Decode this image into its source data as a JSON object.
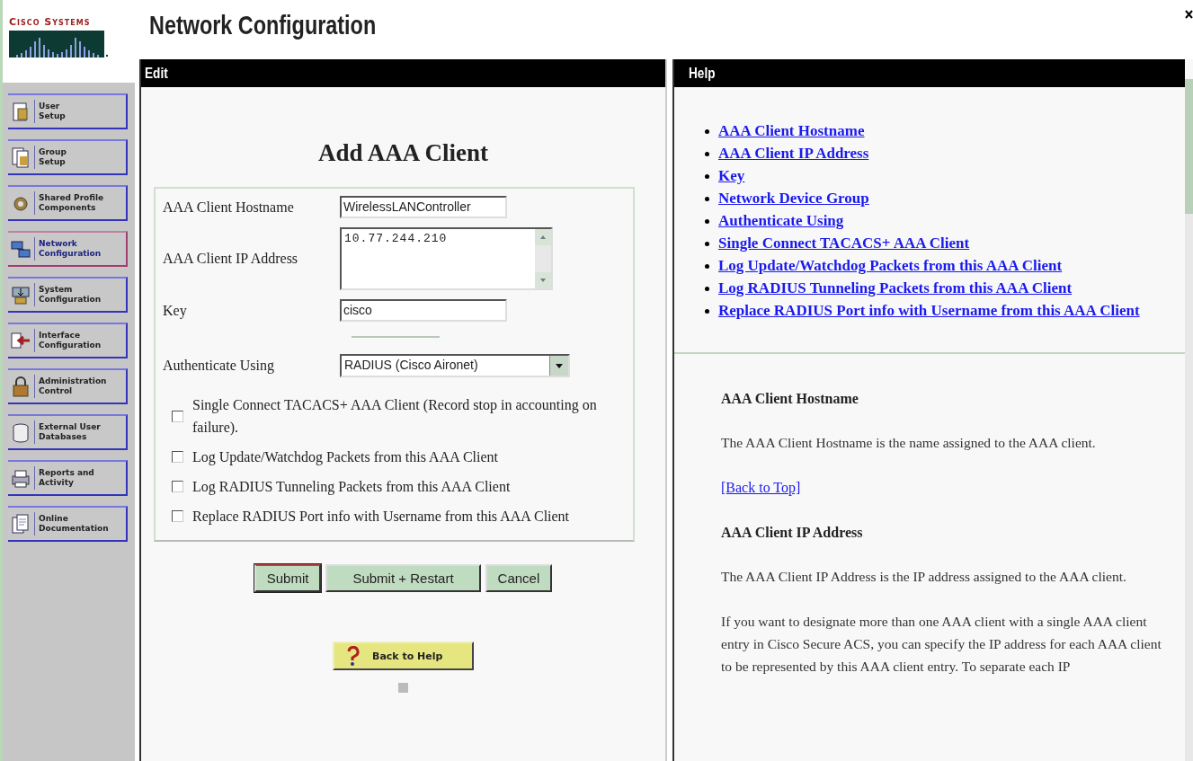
{
  "logo": {
    "text": "Cisco Systems"
  },
  "page_title": "Network Configuration",
  "nav": [
    {
      "lines": [
        "User",
        "Setup"
      ],
      "selected": false
    },
    {
      "lines": [
        "Group",
        "Setup"
      ],
      "selected": false
    },
    {
      "lines": [
        "Shared Profile",
        "Components"
      ],
      "selected": false
    },
    {
      "lines": [
        "Network",
        "Configuration"
      ],
      "selected": true
    },
    {
      "lines": [
        "System",
        "Configuration"
      ],
      "selected": false
    },
    {
      "lines": [
        "Interface",
        "Configuration"
      ],
      "selected": false
    },
    {
      "lines": [
        "Administration",
        "Control"
      ],
      "selected": false
    },
    {
      "lines": [
        "External User",
        "Databases"
      ],
      "selected": false
    },
    {
      "lines": [
        "Reports and",
        "Activity"
      ],
      "selected": false
    },
    {
      "lines": [
        "Online",
        "Documentation"
      ],
      "selected": false
    }
  ],
  "edit": {
    "header": "Edit",
    "title": "Add AAA Client",
    "fields": [
      {
        "kind": "text",
        "label": "AAA Client Hostname",
        "value": "WirelessLANController"
      },
      {
        "kind": "textarea",
        "label": "AAA Client IP Address",
        "value": "10.77.244.210"
      },
      {
        "kind": "text",
        "label": "Key",
        "value": "cisco"
      },
      {
        "kind": "select",
        "label": "Authenticate Using",
        "value": "RADIUS (Cisco Aironet)"
      }
    ],
    "checkboxes": [
      {
        "label": "Single Connect TACACS+ AAA Client (Record stop in accounting on failure).",
        "checked": false
      },
      {
        "label": "Log Update/Watchdog Packets from this AAA Client",
        "checked": false
      },
      {
        "label": "Log RADIUS Tunneling Packets from this AAA Client",
        "checked": false
      },
      {
        "label": "Replace RADIUS Port info with Username from this AAA Client",
        "checked": false
      }
    ],
    "buttons": [
      {
        "label": "Submit",
        "focused": true
      },
      {
        "label": "Submit + Restart",
        "focused": false
      },
      {
        "label": "Cancel",
        "focused": false
      }
    ],
    "help_button": "Back to Help"
  },
  "help": {
    "header": "Help",
    "links": [
      "AAA Client Hostname",
      "AAA Client IP Address",
      "Key",
      "Network Device Group",
      "Authenticate Using",
      "Single Connect TACACS+ AAA Client",
      "Log Update/Watchdog Packets from this AAA Client",
      "Log RADIUS Tunneling Packets from this AAA Client",
      "Replace RADIUS Port info with Username from this AAA Client"
    ],
    "sections": [
      {
        "heading": "AAA Client Hostname",
        "paragraphs": [
          "The AAA Client Hostname is the name assigned to the AAA client."
        ],
        "back_link": "[Back to Top]"
      },
      {
        "heading": "AAA Client IP Address",
        "paragraphs": [
          "The AAA Client IP Address is the IP address assigned to the AAA client.",
          "If you want to designate more than one AAA client with a single AAA client entry in Cisco Secure ACS, you can specify the IP address for each AAA client to be represented by this AAA client entry. To separate each IP"
        ]
      }
    ]
  }
}
